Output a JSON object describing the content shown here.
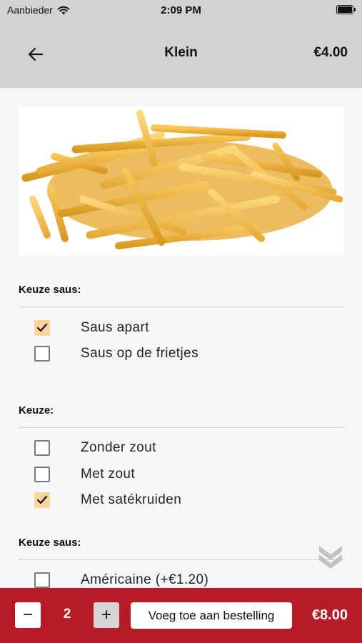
{
  "status_bar": {
    "carrier": "Aanbieder",
    "time": "2:09 PM"
  },
  "header": {
    "title": "Klein",
    "price": "€4.00",
    "back_icon": "arrow-left-icon"
  },
  "sections": [
    {
      "title": "Keuze saus:",
      "options": [
        {
          "label": "Saus apart",
          "checked": true
        },
        {
          "label": "Saus op de frietjes",
          "checked": false
        }
      ]
    },
    {
      "title": "Keuze:",
      "options": [
        {
          "label": "Zonder zout",
          "checked": false
        },
        {
          "label": "Met zout",
          "checked": false
        },
        {
          "label": "Met satékruiden",
          "checked": true
        }
      ]
    },
    {
      "title": "Keuze saus:",
      "options": [
        {
          "label": "Américaine (+€1.20)",
          "checked": false
        }
      ]
    }
  ],
  "footer": {
    "minus_label": "−",
    "quantity": "2",
    "plus_label": "+",
    "add_button_label": "Voeg toe aan bestelling",
    "total": "€8.00"
  },
  "colors": {
    "brand_red": "#b71b25",
    "checked_fill": "#fcd39a",
    "header_gray": "#d2d2d2"
  }
}
